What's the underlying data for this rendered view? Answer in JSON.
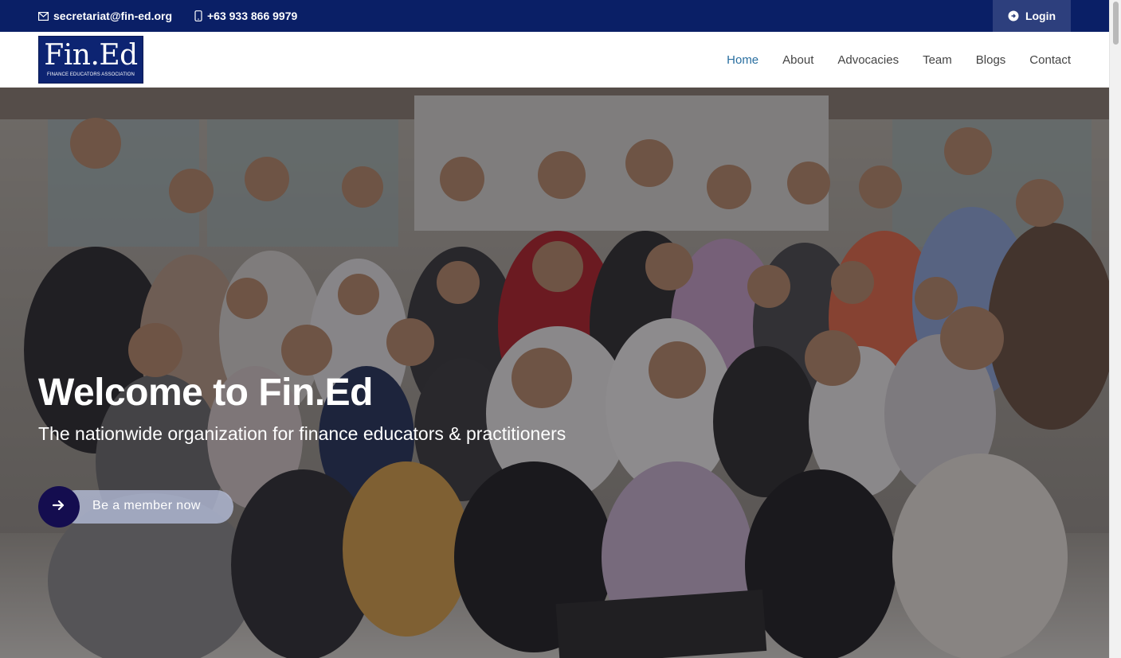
{
  "topbar": {
    "email": "secretariat@fin-ed.org",
    "phone": "+63 933 866 9979",
    "login_label": "Login"
  },
  "logo": {
    "mark": "Fin.Ed",
    "subtitle": "FINANCE EDUCATORS ASSOCIATION"
  },
  "nav": {
    "items": [
      "Home",
      "About",
      "Advocacies",
      "Team",
      "Blogs",
      "Contact"
    ],
    "active": "Home"
  },
  "hero": {
    "title": "Welcome to Fin.Ed",
    "tagline": "The nationwide organization for finance educators & practitioners",
    "cta_label": "Be a member now"
  },
  "colors": {
    "topbar_bg": "#0a1f66",
    "logo_bg": "#0d2472",
    "nav_active": "#2a6fa0",
    "cta_circle": "#140d4f"
  }
}
